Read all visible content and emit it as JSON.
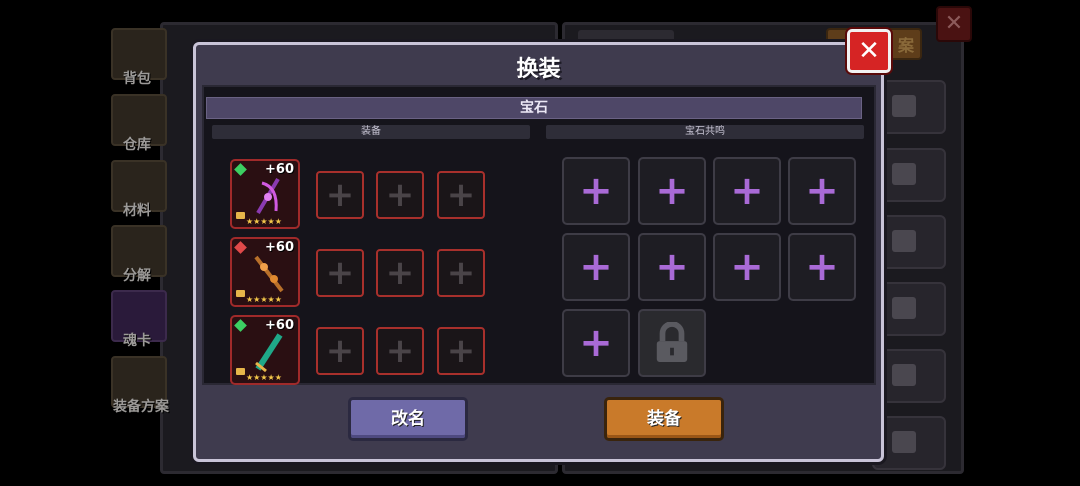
{
  "dialog": {
    "title": "换装",
    "section_title": "宝石",
    "left_subtitle": "装备",
    "right_subtitle": "宝石共鸣",
    "rename_button": "改名",
    "equip_button": "装备",
    "close_symbol": "✕"
  },
  "weapons": [
    {
      "level": "+60",
      "gem_color": "#3ccf62",
      "stars": "★★★★★",
      "weapon_color": "#b04ad0"
    },
    {
      "level": "+60",
      "gem_color": "#e04a4a",
      "stars": "★★★★★",
      "weapon_color": "#d08a3a"
    },
    {
      "level": "+60",
      "gem_color": "#3ccf62",
      "stars": "★★★★★",
      "weapon_color": "#2fc9a6"
    }
  ],
  "gem_slot_symbol": "+",
  "resonance_slot_symbol": "+",
  "sidebar": {
    "items": [
      {
        "label": "背包",
        "icon": "backpack-icon"
      },
      {
        "label": "仓库",
        "icon": "warehouse-icon"
      },
      {
        "label": "材料",
        "icon": "materials-icon"
      },
      {
        "label": "分解",
        "icon": "decompose-icon"
      },
      {
        "label": "魂卡",
        "icon": "soul-card-icon"
      },
      {
        "label": "装备方案",
        "icon": "equipment-plan-icon"
      }
    ]
  },
  "background": {
    "tab_label": "案",
    "close_symbol": "✕"
  },
  "colors": {
    "dialog_bg": "#3f3b4e",
    "accent_purple": "#a96ad6",
    "equip_orange": "#c97a2a",
    "rename_purple": "#6f6aa8",
    "close_red": "#d62424"
  }
}
